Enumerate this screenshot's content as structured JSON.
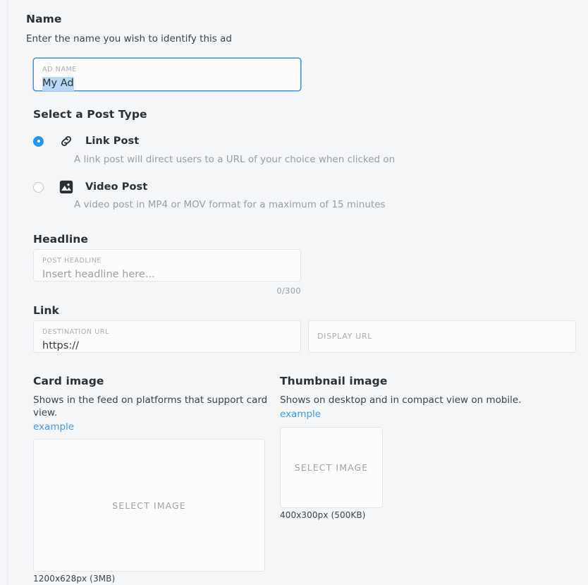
{
  "theme": {
    "background": "#f4f6f8",
    "field_background": "#fdfcfa",
    "border": "#e3e5e8",
    "accent": "#2196f3",
    "focus_border": "#3d8fe0",
    "link": "#3b9bea",
    "selection_highlight": "#b9d7f7",
    "text": "#2b3034",
    "muted_text": "#979ea5"
  },
  "name_section": {
    "title": "Name",
    "description": "Enter the name you wish to identify this ad",
    "ad_name_field": {
      "label": "AD NAME",
      "value": "My Ad",
      "focused": true,
      "text_selected": true
    }
  },
  "post_type_section": {
    "title": "Select a Post Type",
    "options": [
      {
        "label": "Link Post",
        "description": "A link post will direct users to a URL of your choice when clicked on",
        "icon": "link-icon",
        "selected": true
      },
      {
        "label": "Video Post",
        "description": "A video post in MP4 or MOV format for a maximum of 15 minutes",
        "icon": "image-icon",
        "selected": false
      }
    ]
  },
  "headline_section": {
    "title": "Headline",
    "field": {
      "label": "POST HEADLINE",
      "placeholder": "Insert headline here...",
      "value": ""
    },
    "counter": "0/300"
  },
  "link_section": {
    "title": "Link",
    "destination_url": {
      "label": "DESTINATION URL",
      "value": "https://"
    },
    "display_url": {
      "label": "DISPLAY URL",
      "value": ""
    }
  },
  "card_image_section": {
    "title": "Card image",
    "description": "Shows in the feed on platforms that support card view.",
    "example_link": "example",
    "dropzone_label": "SELECT IMAGE",
    "spec": "1200x628px (3MB)"
  },
  "thumbnail_image_section": {
    "title": "Thumbnail image",
    "description": "Shows on desktop and in compact view on mobile.",
    "example_link": "example",
    "dropzone_label": "SELECT IMAGE",
    "spec": "400x300px (500KB)"
  }
}
